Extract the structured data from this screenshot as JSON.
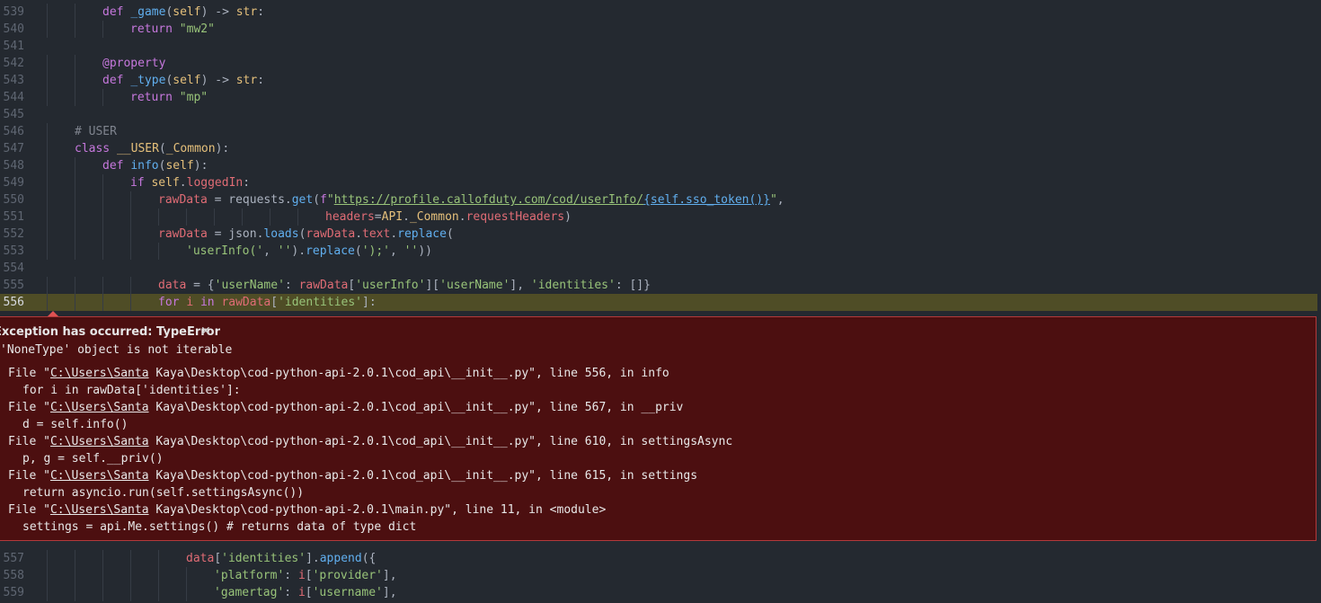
{
  "editor": {
    "lines_above": [
      {
        "n": "539",
        "indent": 2,
        "tokens": [
          [
            "kw",
            "def "
          ],
          [
            "fn",
            "_game"
          ],
          [
            "pl",
            "("
          ],
          [
            "self",
            "self"
          ],
          [
            "pl",
            ") -> "
          ],
          [
            "cls",
            "str"
          ],
          [
            "pl",
            ":"
          ]
        ]
      },
      {
        "n": "540",
        "indent": 3,
        "tokens": [
          [
            "kw",
            "return "
          ],
          [
            "str",
            "\"mw2\""
          ]
        ]
      },
      {
        "n": "541",
        "indent": 0,
        "tokens": []
      },
      {
        "n": "542",
        "indent": 2,
        "tokens": [
          [
            "dec",
            "@property"
          ]
        ]
      },
      {
        "n": "543",
        "indent": 2,
        "tokens": [
          [
            "kw",
            "def "
          ],
          [
            "fn",
            "_type"
          ],
          [
            "pl",
            "("
          ],
          [
            "self",
            "self"
          ],
          [
            "pl",
            ") -> "
          ],
          [
            "cls",
            "str"
          ],
          [
            "pl",
            ":"
          ]
        ]
      },
      {
        "n": "544",
        "indent": 3,
        "tokens": [
          [
            "kw",
            "return "
          ],
          [
            "str",
            "\"mp\""
          ]
        ]
      },
      {
        "n": "545",
        "indent": 0,
        "tokens": []
      },
      {
        "n": "546",
        "indent": 1,
        "tokens": [
          [
            "cmt",
            "# USER"
          ]
        ]
      },
      {
        "n": "547",
        "indent": 1,
        "tokens": [
          [
            "kw",
            "class "
          ],
          [
            "cls",
            "__USER"
          ],
          [
            "pl",
            "("
          ],
          [
            "cls",
            "_Common"
          ],
          [
            "pl",
            "):"
          ]
        ]
      },
      {
        "n": "548",
        "indent": 2,
        "tokens": [
          [
            "kw",
            "def "
          ],
          [
            "fn",
            "info"
          ],
          [
            "pl",
            "("
          ],
          [
            "self",
            "self"
          ],
          [
            "pl",
            "):"
          ]
        ]
      },
      {
        "n": "549",
        "indent": 3,
        "tokens": [
          [
            "kw",
            "if "
          ],
          [
            "self",
            "self"
          ],
          [
            "pl",
            "."
          ],
          [
            "var",
            "loggedIn"
          ],
          [
            "pl",
            ":"
          ]
        ]
      },
      {
        "n": "550",
        "indent": 4,
        "tokens": [
          [
            "var",
            "rawData"
          ],
          [
            "pl",
            " = "
          ],
          [
            "pl",
            "requests."
          ],
          [
            "fn",
            "get"
          ],
          [
            "pl",
            "("
          ],
          [
            "kw",
            "f"
          ],
          [
            "str",
            "\""
          ],
          [
            "url",
            "https://profile.callofduty.com/cod/userInfo/"
          ],
          [
            "urlsub",
            "{self.sso_token()}"
          ],
          [
            "str",
            "\""
          ],
          [
            "pl",
            ","
          ]
        ]
      },
      {
        "n": "551",
        "indent": 10,
        "tokens": [
          [
            "var",
            "headers"
          ],
          [
            "pl",
            "="
          ],
          [
            "cls",
            "API"
          ],
          [
            "pl",
            "."
          ],
          [
            "cls",
            "_Common"
          ],
          [
            "pl",
            "."
          ],
          [
            "var",
            "requestHeaders"
          ],
          [
            "pl",
            ")"
          ]
        ]
      },
      {
        "n": "552",
        "indent": 4,
        "tokens": [
          [
            "var",
            "rawData"
          ],
          [
            "pl",
            " = "
          ],
          [
            "pl",
            "json."
          ],
          [
            "fn",
            "loads"
          ],
          [
            "pl",
            "("
          ],
          [
            "var",
            "rawData"
          ],
          [
            "pl",
            "."
          ],
          [
            "var",
            "text"
          ],
          [
            "pl",
            "."
          ],
          [
            "fn",
            "replace"
          ],
          [
            "pl",
            "("
          ]
        ]
      },
      {
        "n": "553",
        "indent": 5,
        "tokens": [
          [
            "str",
            "'userInfo('"
          ],
          [
            "pl",
            ", "
          ],
          [
            "str",
            "''"
          ],
          [
            "pl",
            ")."
          ],
          [
            "fn",
            "replace"
          ],
          [
            "pl",
            "("
          ],
          [
            "str",
            "');'"
          ],
          [
            "pl",
            ", "
          ],
          [
            "str",
            "''"
          ],
          [
            "pl",
            "))"
          ]
        ]
      },
      {
        "n": "554",
        "indent": 0,
        "tokens": []
      },
      {
        "n": "555",
        "indent": 4,
        "tokens": [
          [
            "var",
            "data"
          ],
          [
            "pl",
            " = {"
          ],
          [
            "str",
            "'userName'"
          ],
          [
            "pl",
            ": "
          ],
          [
            "var",
            "rawData"
          ],
          [
            "pl",
            "["
          ],
          [
            "str",
            "'userInfo'"
          ],
          [
            "pl",
            "]["
          ],
          [
            "str",
            "'userName'"
          ],
          [
            "pl",
            "], "
          ],
          [
            "str",
            "'identities'"
          ],
          [
            "pl",
            ": []}"
          ]
        ]
      },
      {
        "n": "556",
        "indent": 4,
        "active": true,
        "tokens": [
          [
            "kw",
            "for "
          ],
          [
            "var",
            "i "
          ],
          [
            "kw",
            "in "
          ],
          [
            "var",
            "rawData"
          ],
          [
            "pl",
            "["
          ],
          [
            "str",
            "'identities'"
          ],
          [
            "pl",
            "]:"
          ]
        ]
      }
    ],
    "lines_below": [
      {
        "n": "557",
        "indent": 5,
        "tokens": [
          [
            "var",
            "data"
          ],
          [
            "pl",
            "["
          ],
          [
            "str",
            "'identities'"
          ],
          [
            "pl",
            "]."
          ],
          [
            "fn",
            "append"
          ],
          [
            "pl",
            "({"
          ]
        ]
      },
      {
        "n": "558",
        "indent": 6,
        "tokens": [
          [
            "str",
            "'platform'"
          ],
          [
            "pl",
            ": "
          ],
          [
            "var",
            "i"
          ],
          [
            "pl",
            "["
          ],
          [
            "str",
            "'provider'"
          ],
          [
            "pl",
            "],"
          ]
        ]
      },
      {
        "n": "559",
        "indent": 6,
        "tokens": [
          [
            "str",
            "'gamertag'"
          ],
          [
            "pl",
            ": "
          ],
          [
            "var",
            "i"
          ],
          [
            "pl",
            "["
          ],
          [
            "str",
            "'username'"
          ],
          [
            "pl",
            "],"
          ]
        ]
      }
    ]
  },
  "exception": {
    "title": "Exception has occurred: TypeError",
    "close_glyph": "✕",
    "message": "'NoneType' object is not iterable",
    "traceback": [
      {
        "pre": "File \"",
        "path": "C:\\Users\\Santa",
        "post": " Kaya\\Desktop\\cod-python-api-2.0.1\\cod_api\\__init__.py\", line 556, in info",
        "code": "for i in rawData['identities']:"
      },
      {
        "pre": "File \"",
        "path": "C:\\Users\\Santa",
        "post": " Kaya\\Desktop\\cod-python-api-2.0.1\\cod_api\\__init__.py\", line 567, in __priv",
        "code": "d = self.info()"
      },
      {
        "pre": "File \"",
        "path": "C:\\Users\\Santa",
        "post": " Kaya\\Desktop\\cod-python-api-2.0.1\\cod_api\\__init__.py\", line 610, in settingsAsync",
        "code": "p, g = self.__priv()"
      },
      {
        "pre": "File \"",
        "path": "C:\\Users\\Santa",
        "post": " Kaya\\Desktop\\cod-python-api-2.0.1\\cod_api\\__init__.py\", line 615, in settings",
        "code": "return asyncio.run(self.settingsAsync())"
      },
      {
        "pre": "File \"",
        "path": "C:\\Users\\Santa",
        "post": " Kaya\\Desktop\\cod-python-api-2.0.1\\main.py\", line 11, in <module>",
        "code": "settings = api.Me.settings() # returns data of type dict"
      }
    ]
  },
  "colors": {
    "background": "#242930",
    "active_line": "#4f4d26",
    "exception_bg": "#4c0f10",
    "exception_border": "#b3393b"
  }
}
